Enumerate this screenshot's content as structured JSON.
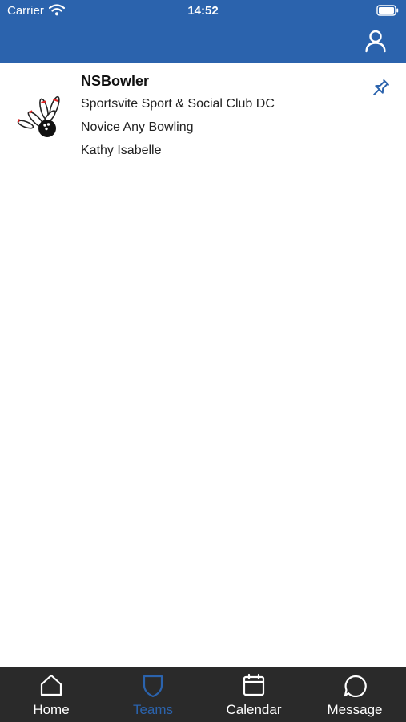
{
  "status_bar": {
    "carrier": "Carrier",
    "time": "14:52"
  },
  "header": {
    "profile_icon": "user-icon"
  },
  "team": {
    "name": "NSBowler",
    "club": "Sportsvite Sport & Social Club DC",
    "league": "Novice Any Bowling",
    "person": "Kathy Isabelle",
    "logo_icon": "bowling-pins-icon",
    "pin_icon": "pin-icon"
  },
  "tabs": [
    {
      "label": "Home",
      "icon": "home-icon",
      "active": false
    },
    {
      "label": "Teams",
      "icon": "shield-icon",
      "active": true
    },
    {
      "label": "Calendar",
      "icon": "calendar-icon",
      "active": false
    },
    {
      "label": "Message",
      "icon": "chat-bubble-icon",
      "active": false
    }
  ],
  "colors": {
    "header_bg": "#2b63ad",
    "tab_bar_bg": "#2a2a2a",
    "active_tab": "#2b63ad"
  }
}
